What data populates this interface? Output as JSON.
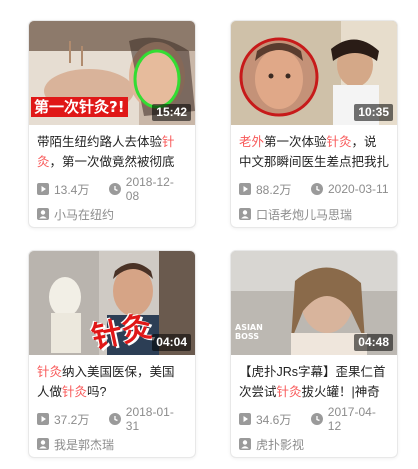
{
  "videos": [
    {
      "duration": "15:42",
      "overlay_text": "第一次针灸?!",
      "title_parts": [
        {
          "text": "带陌生纽约路人去体验",
          "hl": false
        },
        {
          "text": "针灸",
          "hl": true
        },
        {
          "text": "，第一次做竟然被彻底征",
          "hl": false
        }
      ],
      "views": "13.4万",
      "date": "2018-12-08",
      "author": "小马在纽约"
    },
    {
      "duration": "10:35",
      "overlay_text": "",
      "title_parts": [
        {
          "text": "老外",
          "hl": true
        },
        {
          "text": "第一次体验",
          "hl": false
        },
        {
          "text": "针灸",
          "hl": true
        },
        {
          "text": "，说中文那瞬间医生差点把我扎",
          "hl": false
        }
      ],
      "views": "88.2万",
      "date": "2020-03-11",
      "author": "口语老炮儿马思瑞"
    },
    {
      "duration": "04:04",
      "overlay_text": "针灸",
      "title_parts": [
        {
          "text": "针灸",
          "hl": true
        },
        {
          "text": "纳入美国医保，美国人做",
          "hl": false
        },
        {
          "text": "针灸",
          "hl": true
        },
        {
          "text": "吗?",
          "hl": false
        }
      ],
      "views": "37.2万",
      "date": "2018-01-31",
      "author": "我是郭杰瑞"
    },
    {
      "duration": "04:48",
      "overlay_text": "ASIAN BOSS",
      "title_parts": [
        {
          "text": "【虎扑JRs字幕】歪果仁首次尝试",
          "hl": false
        },
        {
          "text": "针灸",
          "hl": true
        },
        {
          "text": "拔火罐！|神奇的",
          "hl": false
        }
      ],
      "views": "34.6万",
      "date": "2017-04-12",
      "author": "虎扑影视"
    }
  ],
  "colors": {
    "highlight": "#f85959",
    "meta": "#8c8c8c"
  },
  "icons": {
    "views": "play-icon",
    "date": "clock-icon",
    "author": "user-icon"
  }
}
